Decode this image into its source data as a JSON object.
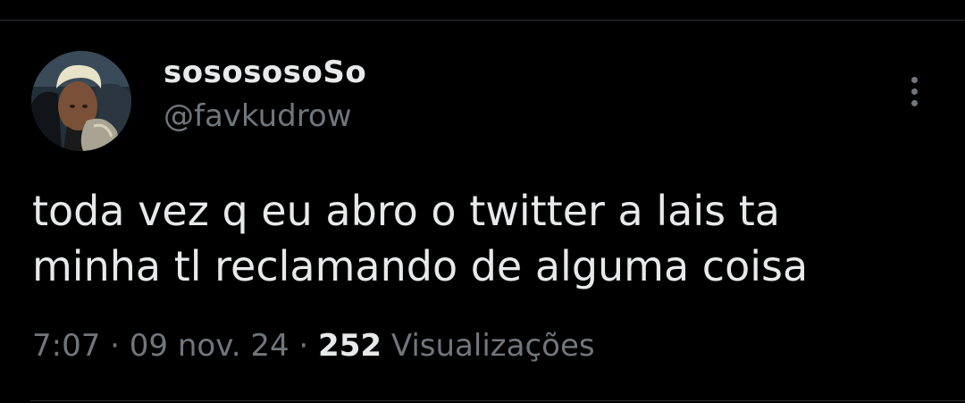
{
  "tweet": {
    "author": {
      "display_name": "sosososoSo",
      "handle": "@favkudrow",
      "avatar_icon": "profile-photo-avatar"
    },
    "more_icon": "more-options-vertical-dots-icon",
    "text_lines": [
      "toda vez q eu abro o twitter a lais ta",
      "minha tl reclamando de alguma coisa"
    ],
    "meta": {
      "time": "7:07",
      "separator": "·",
      "date": "09 nov. 24",
      "views_count": "252",
      "views_label": "Visualizações"
    }
  },
  "colors": {
    "background": "#000000",
    "primary_text": "#e7e9ea",
    "secondary_text": "#71767b",
    "divider": "#2f3336"
  }
}
